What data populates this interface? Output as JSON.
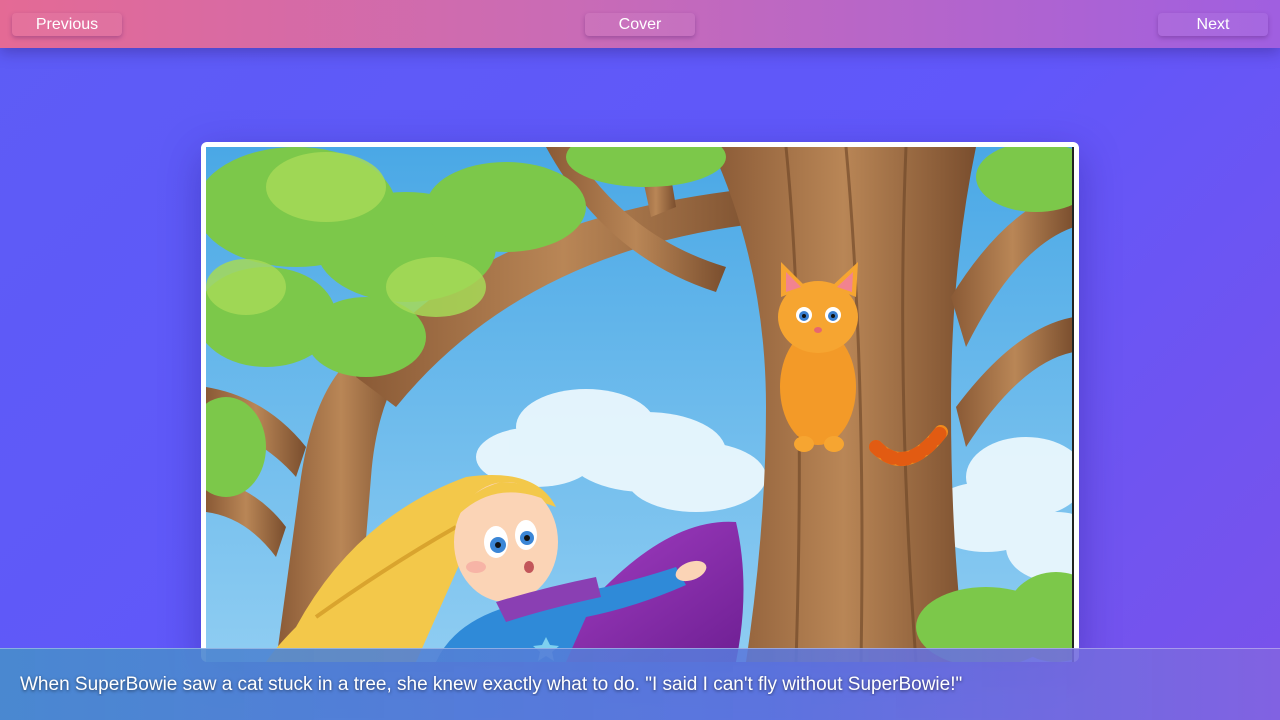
{
  "nav": {
    "previous_label": "Previous",
    "cover_label": "Cover",
    "next_label": "Next"
  },
  "caption": {
    "text": "When SuperBowie saw a cat stuck in a tree, she knew exactly what to do. \"I said I can't fly without SuperBowie!\""
  },
  "illustration": {
    "subject": "girl-superhero-and-cat-in-tree"
  },
  "colors": {
    "background": "#5d5cf6",
    "topbar_start": "#e46a95",
    "topbar_end": "#a05fe0"
  }
}
